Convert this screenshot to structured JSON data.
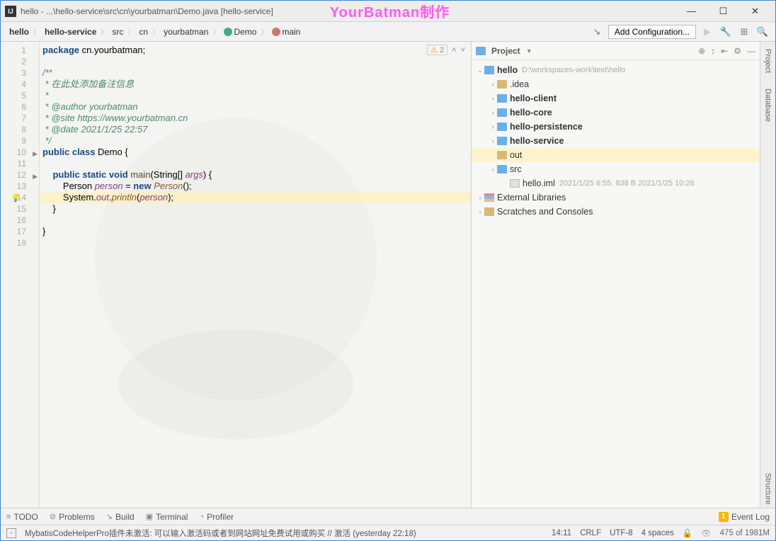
{
  "titlebar": {
    "icon_text": "IJ",
    "title": "hello - ...\\hello-service\\src\\cn\\yourbatman\\Demo.java [hello-service]",
    "watermark": "YourBatman制作"
  },
  "breadcrumbs": {
    "items": [
      "hello",
      "hello-service",
      "src",
      "cn",
      "yourbatman",
      "Demo",
      "main"
    ],
    "add_config": "Add Configuration..."
  },
  "editor": {
    "warn_count": "2",
    "lines": [
      {
        "n": 1,
        "tokens": [
          {
            "t": "pkg",
            "v": "package "
          },
          {
            "t": "",
            "v": "cn.yourbatman;"
          }
        ]
      },
      {
        "n": 2,
        "tokens": []
      },
      {
        "n": 3,
        "tokens": [
          {
            "t": "comment-doc",
            "v": "/**"
          }
        ]
      },
      {
        "n": 4,
        "tokens": [
          {
            "t": "comment-doc",
            "v": " * 在此处添加备注信息"
          }
        ]
      },
      {
        "n": 5,
        "tokens": [
          {
            "t": "comment-doc",
            "v": " *"
          }
        ]
      },
      {
        "n": 6,
        "tokens": [
          {
            "t": "comment-doc",
            "v": " * @author yourbatman"
          }
        ]
      },
      {
        "n": 7,
        "tokens": [
          {
            "t": "comment-doc",
            "v": " * @site https://www.yourbatman.cn"
          }
        ]
      },
      {
        "n": 8,
        "tokens": [
          {
            "t": "comment-doc",
            "v": " * @date 2021/1/25 22:57"
          }
        ]
      },
      {
        "n": 9,
        "tokens": [
          {
            "t": "comment-doc",
            "v": " */"
          }
        ]
      },
      {
        "n": 10,
        "fold": true,
        "tokens": [
          {
            "t": "kw",
            "v": "public class "
          },
          {
            "t": "",
            "v": "Demo {"
          }
        ]
      },
      {
        "n": 11,
        "tokens": []
      },
      {
        "n": 12,
        "fold": true,
        "tokens": [
          {
            "t": "",
            "v": "    "
          },
          {
            "t": "kw",
            "v": "public static void "
          },
          {
            "t": "method",
            "v": "main"
          },
          {
            "t": "",
            "v": "(String[] "
          },
          {
            "t": "ident",
            "v": "args"
          },
          {
            "t": "",
            "v": ") {"
          }
        ]
      },
      {
        "n": 13,
        "tokens": [
          {
            "t": "",
            "v": "        Person "
          },
          {
            "t": "ident",
            "v": "person"
          },
          {
            "t": "",
            "v": " = "
          },
          {
            "t": "kw",
            "v": "new "
          },
          {
            "t": "call",
            "v": "Person"
          },
          {
            "t": "",
            "v": "();"
          }
        ]
      },
      {
        "n": 14,
        "hl": true,
        "bulb": true,
        "tokens": [
          {
            "t": "",
            "v": "        System."
          },
          {
            "t": "ident",
            "v": "out"
          },
          {
            "t": "",
            "v": "."
          },
          {
            "t": "call",
            "v": "println"
          },
          {
            "t": "",
            "v": "("
          },
          {
            "t": "ident",
            "v": "person"
          },
          {
            "t": "",
            "v": ");"
          }
        ]
      },
      {
        "n": 15,
        "tokens": [
          {
            "t": "",
            "v": "    }"
          }
        ]
      },
      {
        "n": 16,
        "tokens": []
      },
      {
        "n": 17,
        "tokens": [
          {
            "t": "",
            "v": "}"
          }
        ]
      },
      {
        "n": 18,
        "tokens": []
      }
    ]
  },
  "project": {
    "title": "Project",
    "root": {
      "label": "hello",
      "path": "D:\\workspaces-work\\test\\hello"
    },
    "nodes": [
      {
        "depth": 1,
        "arrow": ">",
        "icon": "fi-tan",
        "label": ".idea"
      },
      {
        "depth": 1,
        "arrow": ">",
        "icon": "fi-blue",
        "label": "hello-client",
        "bold": true
      },
      {
        "depth": 1,
        "arrow": ">",
        "icon": "fi-blue",
        "label": "hello-core",
        "bold": true
      },
      {
        "depth": 1,
        "arrow": ">",
        "icon": "fi-blue",
        "label": "hello-persistence",
        "bold": true
      },
      {
        "depth": 1,
        "arrow": ">",
        "icon": "fi-blue",
        "label": "hello-service",
        "bold": true
      },
      {
        "depth": 1,
        "arrow": "",
        "icon": "fi-tan",
        "label": "out",
        "sel": true
      },
      {
        "depth": 1,
        "arrow": ">",
        "icon": "fi-blue",
        "label": "src"
      },
      {
        "depth": 2,
        "arrow": "",
        "icon": "fi-file",
        "label": "hello.iml",
        "meta": "2021/1/25 6:55, 838 B 2021/1/25 10:26"
      }
    ],
    "ext_lib": "External Libraries",
    "scratches": "Scratches and Consoles"
  },
  "right_tabs": [
    "Project",
    "Database",
    "Structure"
  ],
  "bottom_tools": {
    "items": [
      "TODO",
      "Problems",
      "Build",
      "Terminal",
      "Profiler"
    ],
    "event_log": "Event Log",
    "event_count": "1"
  },
  "status": {
    "msg": "MybatisCodeHelperPro插件未激活: 可以输入激活码或者到网站网址免费试用或购买 // 激活 (yesterday 22:18)",
    "pos": "14:11",
    "eol": "CRLF",
    "enc": "UTF-8",
    "indent": "4 spaces",
    "mem": "475 of 1981M"
  }
}
